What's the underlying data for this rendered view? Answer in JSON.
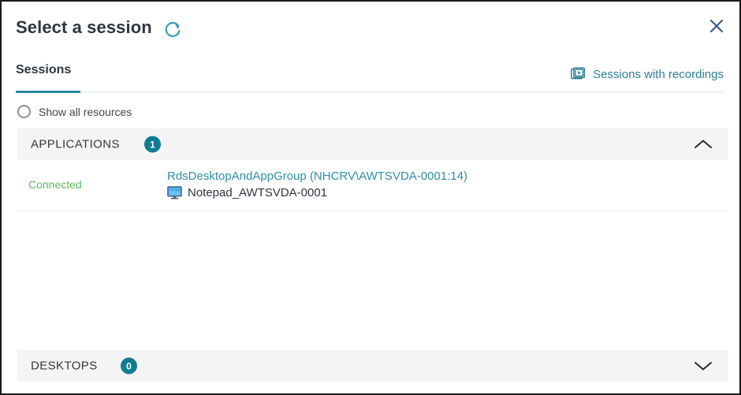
{
  "dialog": {
    "title": "Select a session",
    "refresh_icon": "refresh-icon",
    "close_icon": "close-icon"
  },
  "tabs": {
    "items": [
      {
        "label": "Sessions",
        "active": true
      }
    ],
    "recordings_link": {
      "label": "Sessions with recordings",
      "icon": "video-recordings-icon",
      "color": "#2c7f96"
    }
  },
  "filter": {
    "show_all_resources_label": "Show all resources",
    "checked": false
  },
  "sections": [
    {
      "id": "applications",
      "title": "APPLICATIONS",
      "count": "1",
      "expanded": true,
      "chevron": "chevron-up-icon"
    },
    {
      "id": "desktops",
      "title": "DESKTOPS",
      "count": "0",
      "expanded": false,
      "chevron": "chevron-down-icon"
    }
  ],
  "sessions": [
    {
      "status": "Connected",
      "status_color": "#5cb85c",
      "group": "RdsDesktopAndAppGroup (NHCRV\\AWTSVDA-0001:14)",
      "app_name": "Notepad_AWTSVDA-0001",
      "app_icon": "monitor-icon"
    }
  ],
  "theme": {
    "accent": "#0e7c93",
    "link": "#2d8eaa",
    "tab_underline": "#2a8a9e",
    "header_bg": "#f4f4f4",
    "border": "#1a1a1a"
  }
}
